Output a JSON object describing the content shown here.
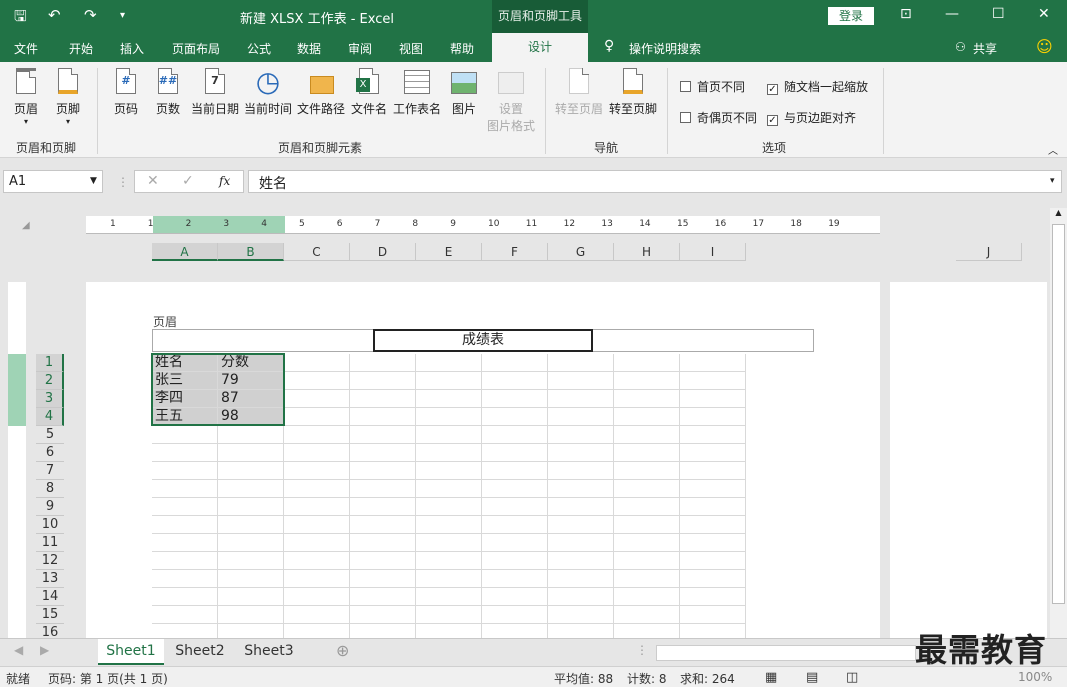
{
  "titlebar": {
    "title": "新建 XLSX 工作表  -  Excel",
    "context_tab": "页眉和页脚工具",
    "login": "登录"
  },
  "tabs": {
    "file": "文件",
    "home": "开始",
    "insert": "插入",
    "layout": "页面布局",
    "formulas": "公式",
    "data": "数据",
    "review": "审阅",
    "view": "视图",
    "help": "帮助",
    "design": "设计",
    "search": "操作说明搜索",
    "share": "共享"
  },
  "ribbon": {
    "header": "页眉",
    "footer": "页脚",
    "group1": "页眉和页脚",
    "page_num": "页码",
    "page_count": "页数",
    "cur_date": "当前日期",
    "cur_time": "当前时间",
    "file_path": "文件路径",
    "file_name": "文件名",
    "sheet_name": "工作表名",
    "picture": "图片",
    "format_pic_1": "设置",
    "format_pic_2": "图片格式",
    "group2": "页眉和页脚元素",
    "goto_header": "转至页眉",
    "goto_footer": "转至页脚",
    "group3": "导航",
    "opt_first": "首页不同",
    "opt_oddeven": "奇偶页不同",
    "opt_scale": "随文档一起缩放",
    "opt_align": "与页边距对齐",
    "group4": "选项"
  },
  "formula": {
    "namebox": "A1",
    "content": "姓名",
    "fx": "fx"
  },
  "ruler": [
    "1",
    "1",
    "2",
    "3",
    "4",
    "5",
    "6",
    "7",
    "8",
    "9",
    "10",
    "11",
    "12",
    "13",
    "14",
    "15",
    "16",
    "17",
    "18",
    "19"
  ],
  "columns": [
    "A",
    "B",
    "C",
    "D",
    "E",
    "F",
    "G",
    "H",
    "I",
    "J"
  ],
  "rows": [
    "1",
    "2",
    "3",
    "4",
    "5",
    "6",
    "7",
    "8",
    "9",
    "10",
    "11",
    "12",
    "13",
    "14",
    "15",
    "16"
  ],
  "page_header": {
    "label": "页眉",
    "center": "成绩表"
  },
  "cells": [
    [
      "姓名",
      "分数"
    ],
    [
      "张三",
      "79"
    ],
    [
      "李四",
      "87"
    ],
    [
      "王五",
      "98"
    ]
  ],
  "sheets": [
    "Sheet1",
    "Sheet2",
    "Sheet3"
  ],
  "status": {
    "mode": "就绪",
    "page": "页码: 第 1 页(共 1 页)",
    "avg": "平均值: 88",
    "count": "计数: 8",
    "sum": "求和: 264",
    "zoom": "100%"
  },
  "watermark": "最需教育"
}
